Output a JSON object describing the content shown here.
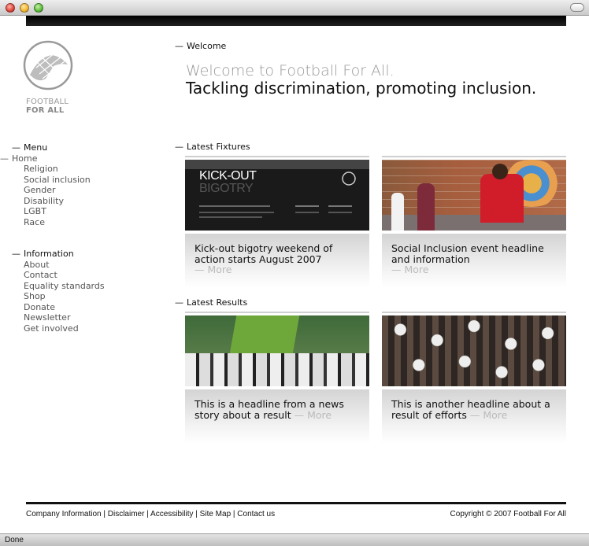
{
  "browser": {
    "status": "Done"
  },
  "logo": {
    "line1": "FOOTBALL",
    "line2": "FOR ALL"
  },
  "nav": {
    "menu_heading": "Menu",
    "menu_items": [
      "Home",
      "Religion",
      "Social inclusion",
      "Gender",
      "Disability",
      "LGBT",
      "Race"
    ],
    "info_heading": "Information",
    "info_items": [
      "About",
      "Contact",
      "Equality standards",
      "Shop",
      "Donate",
      "Newsletter",
      "Get involved"
    ]
  },
  "welcome": {
    "section_label": "Welcome",
    "subtitle": "Welcome to Football For All.",
    "title": "Tackling discrimination, promoting inclusion."
  },
  "fixtures": {
    "section_label": "Latest Fixtures",
    "cards": [
      {
        "headline": "Kick-out bigotry weekend of action starts August 2007",
        "more": "— More",
        "image_text_1": "KICK-OUT",
        "image_text_2": "BIGOTRY"
      },
      {
        "headline": "Social Inclusion event headline and information",
        "more": "— More"
      }
    ]
  },
  "results": {
    "section_label": "Latest Results",
    "cards": [
      {
        "headline": "This is a headline from a news story about a result",
        "more": "— More"
      },
      {
        "headline": "This is another headline about a result of efforts",
        "more": "— More"
      }
    ]
  },
  "footer": {
    "links": [
      "Company Information",
      "Disclaimer",
      "Accessibility",
      "Site Map",
      "Contact us"
    ],
    "copyright": "Copyright © 2007 Football For All"
  },
  "colors": {
    "accent_dark": "#111111",
    "muted": "#999999",
    "link_gray": "#555555"
  }
}
